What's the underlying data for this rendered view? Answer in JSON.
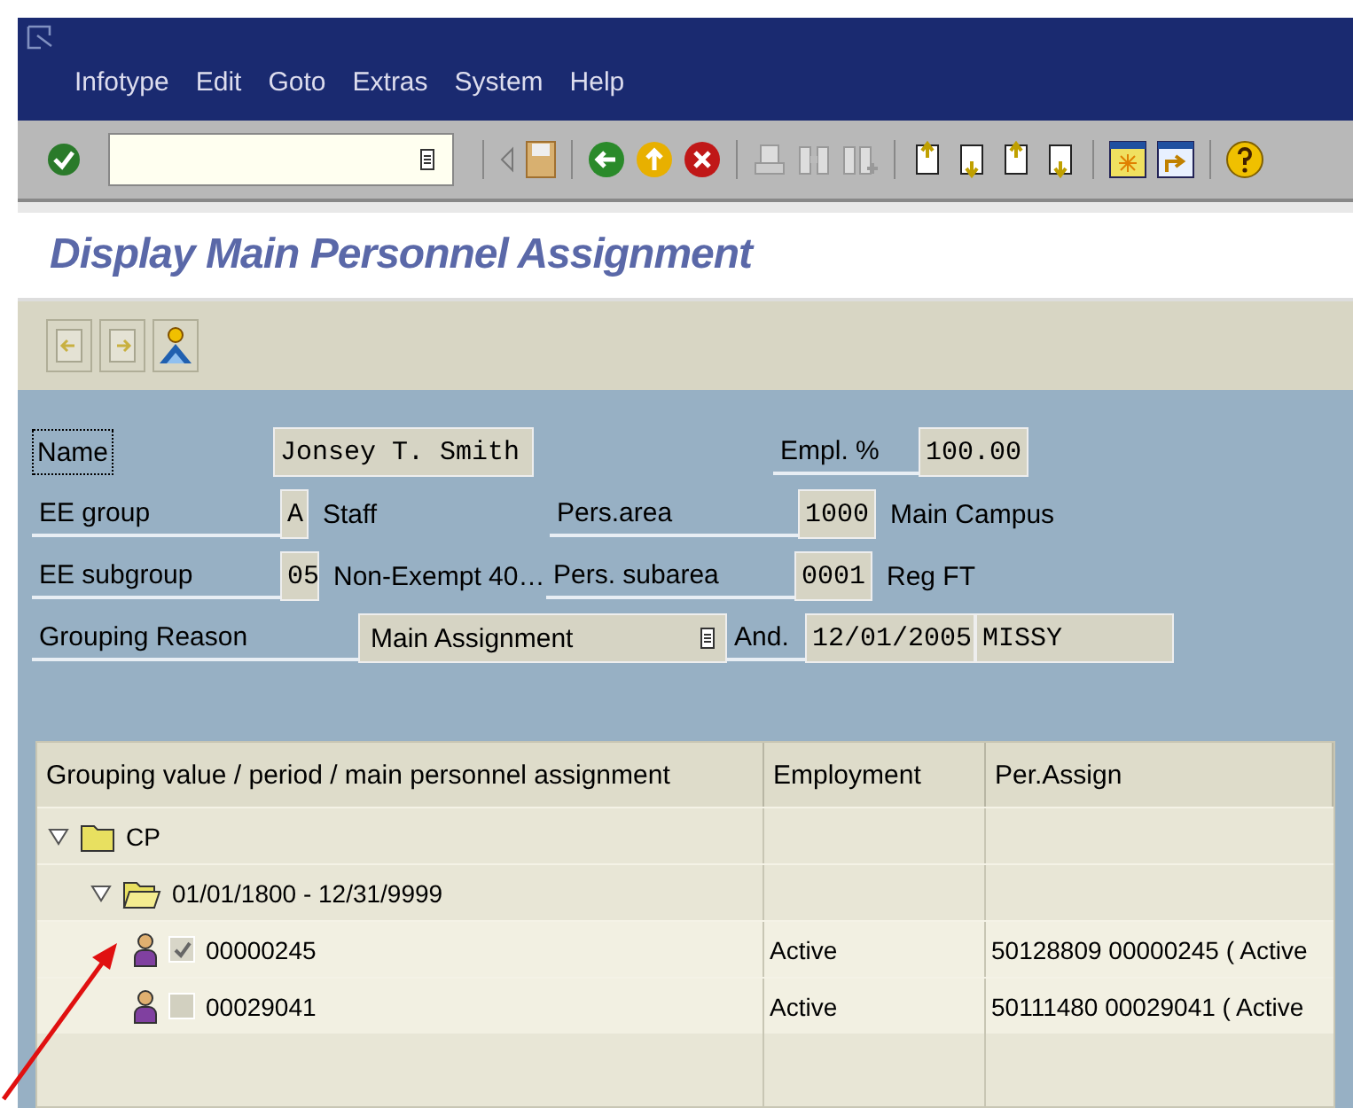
{
  "menu": [
    {
      "label": "Infotype"
    },
    {
      "label": "Edit"
    },
    {
      "label": "Goto"
    },
    {
      "label": "Extras"
    },
    {
      "label": "System"
    },
    {
      "label": "Help"
    }
  ],
  "title": "Display Main Personnel Assignment",
  "form": {
    "name": {
      "label": "Name",
      "focused": true,
      "value": "Jonsey T. Smith"
    },
    "empl_pct": {
      "label": "Empl. %",
      "value": "100.00"
    },
    "ee_group": {
      "label": "EE group",
      "code": "A",
      "text": "Staff"
    },
    "pers_area": {
      "label": "Pers.area",
      "code": "1000",
      "text": "Main Campus"
    },
    "ee_subgroup": {
      "label": "EE subgroup",
      "code": "05",
      "text": "Non-Exempt 40…"
    },
    "pers_subarea": {
      "label": "Pers. subarea",
      "code": "0001",
      "text": "Reg FT"
    },
    "grouping_reason": {
      "label": "Grouping Reason",
      "value": "Main Assignment"
    },
    "and": {
      "label": "And.",
      "date": "12/01/2005",
      "user": "MISSY"
    }
  },
  "tree": {
    "columns": [
      "Grouping value / period / main personnel assignment",
      "Employment",
      "Per.Assign"
    ],
    "nodes": [
      {
        "kind": "folder",
        "label": "CP",
        "expanded": true,
        "children": [
          {
            "kind": "period",
            "label": "01/01/1800 - 12/31/9999",
            "expanded": true,
            "children": [
              {
                "kind": "person",
                "label": "00000245",
                "checked": true,
                "employment": "Active",
                "per_assign": "50128809 00000245 ( Active"
              },
              {
                "kind": "person",
                "label": "00029041",
                "checked": false,
                "employment": "Active",
                "per_assign": "50111480 00029041 ( Active"
              }
            ]
          }
        ]
      }
    ]
  }
}
